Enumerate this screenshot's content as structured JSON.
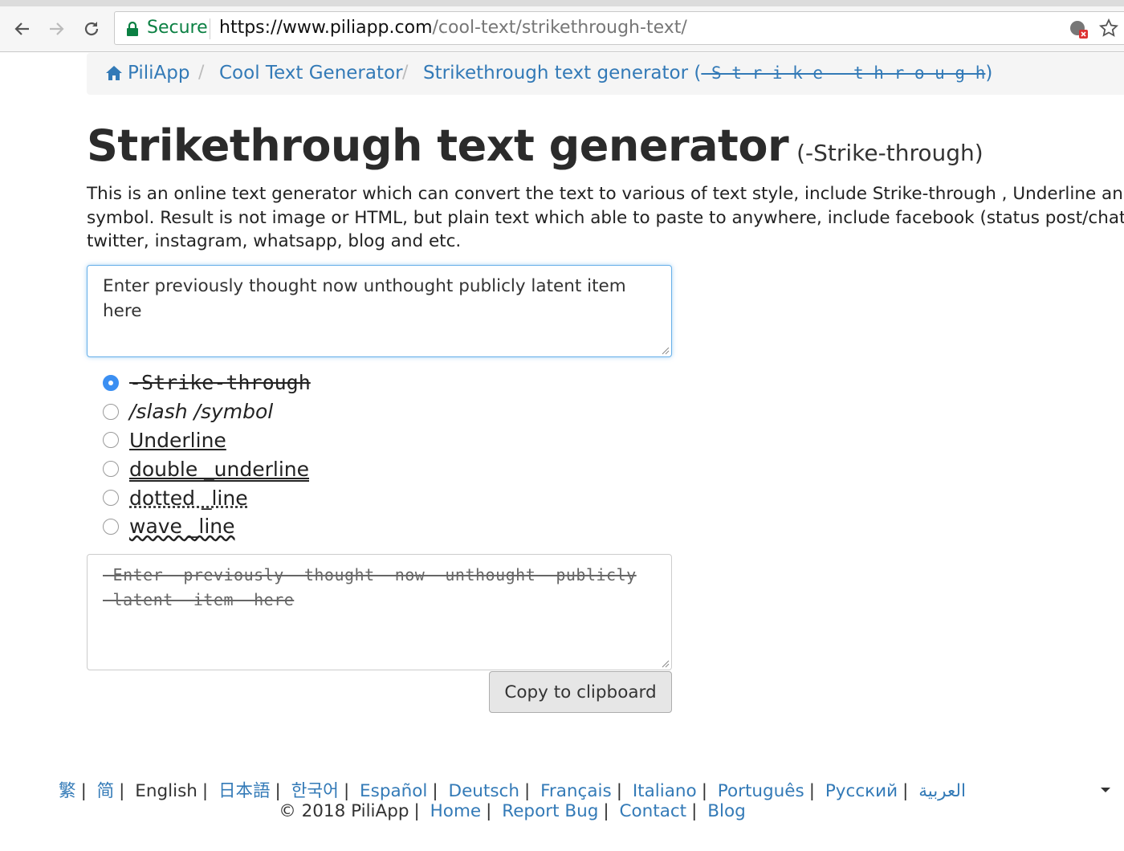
{
  "browser": {
    "secure_label": "Secure",
    "url_scheme": "https://",
    "url_host": "www.piliapp.com",
    "url_path": "/cool-text/strikethrough-text/"
  },
  "breadcrumb": {
    "home": "PiliApp",
    "section": "Cool Text Generator",
    "current": "Strikethrough text generator (",
    "current_styled": "-S-t-r-i-k-e---t-h-r-o-u-g-h",
    "current_close": ")"
  },
  "page": {
    "title": "Strikethrough text generator",
    "subtitle": "(-Strike-through)",
    "intro": [
      "This is an online text generator which can convert the text to various of text style, include Strike-through , Underline and t",
      "symbol. Result is not image or HTML, but plain text which able to paste to anywhere, include facebook (status post/chat/c",
      "twitter, instagram, whatsapp, blog and etc."
    ]
  },
  "input": {
    "value": "Enter previously thought now unthought publicly latent item here"
  },
  "options": [
    {
      "label": "-Strike-through",
      "selected": true
    },
    {
      "label": "/slash /symbol",
      "selected": false
    },
    {
      "label": "Underline ",
      "selected": false
    },
    {
      "label": "double _underline",
      "selected": false
    },
    {
      "label": "dotted _line",
      "selected": false
    },
    {
      "label": "wave _line",
      "selected": false
    }
  ],
  "output": {
    "value": "-Enter -previously -thought -now -unthought -publicly -latent -item -here"
  },
  "copy_button": "Copy to clipboard",
  "footer": {
    "languages": [
      "繁",
      "简",
      "English",
      "日本語",
      "한국어",
      "Español",
      "Deutsch",
      "Français",
      "Italiano",
      "Português",
      "Русский",
      "العربية"
    ],
    "copyright": "© 2018 PiliApp",
    "links": [
      "Home",
      "Report Bug",
      "Contact",
      "Blog"
    ]
  },
  "colors": {
    "link": "#337ab7",
    "secure_green": "#0b8043",
    "radio_selected": "#3b8ff2",
    "focus_border": "#66afe9"
  }
}
